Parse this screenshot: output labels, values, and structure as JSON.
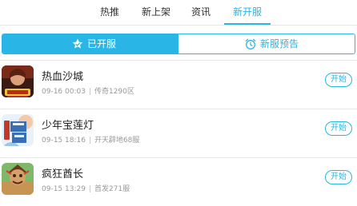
{
  "tabs": [
    {
      "label": "热推",
      "active": false
    },
    {
      "label": "新上架",
      "active": false
    },
    {
      "label": "资讯",
      "active": false
    },
    {
      "label": "新开服",
      "active": true
    }
  ],
  "segments": {
    "opened": {
      "label": "已开服",
      "icon": "star-badge-icon",
      "active": true
    },
    "upcoming": {
      "label": "新服预告",
      "icon": "alarm-clock-icon",
      "active": false
    }
  },
  "servers": [
    {
      "name": "热血沙城",
      "time": "09-16 00:03",
      "server": "传奇1290区",
      "action": "开始",
      "thumb_icon": "game-thumbnail"
    },
    {
      "name": "少年宝莲灯",
      "time": "09-15 18:16",
      "server": "开天辟地68服",
      "action": "开始",
      "thumb_icon": "game-thumbnail"
    },
    {
      "name": "疯狂酋长",
      "time": "09-15 13:29",
      "server": "首发271服",
      "action": "开始",
      "thumb_icon": "game-thumbnail"
    }
  ],
  "colors": {
    "accent": "#29b6e6",
    "divider": "#e8e8e8",
    "meta_text": "#999999"
  }
}
